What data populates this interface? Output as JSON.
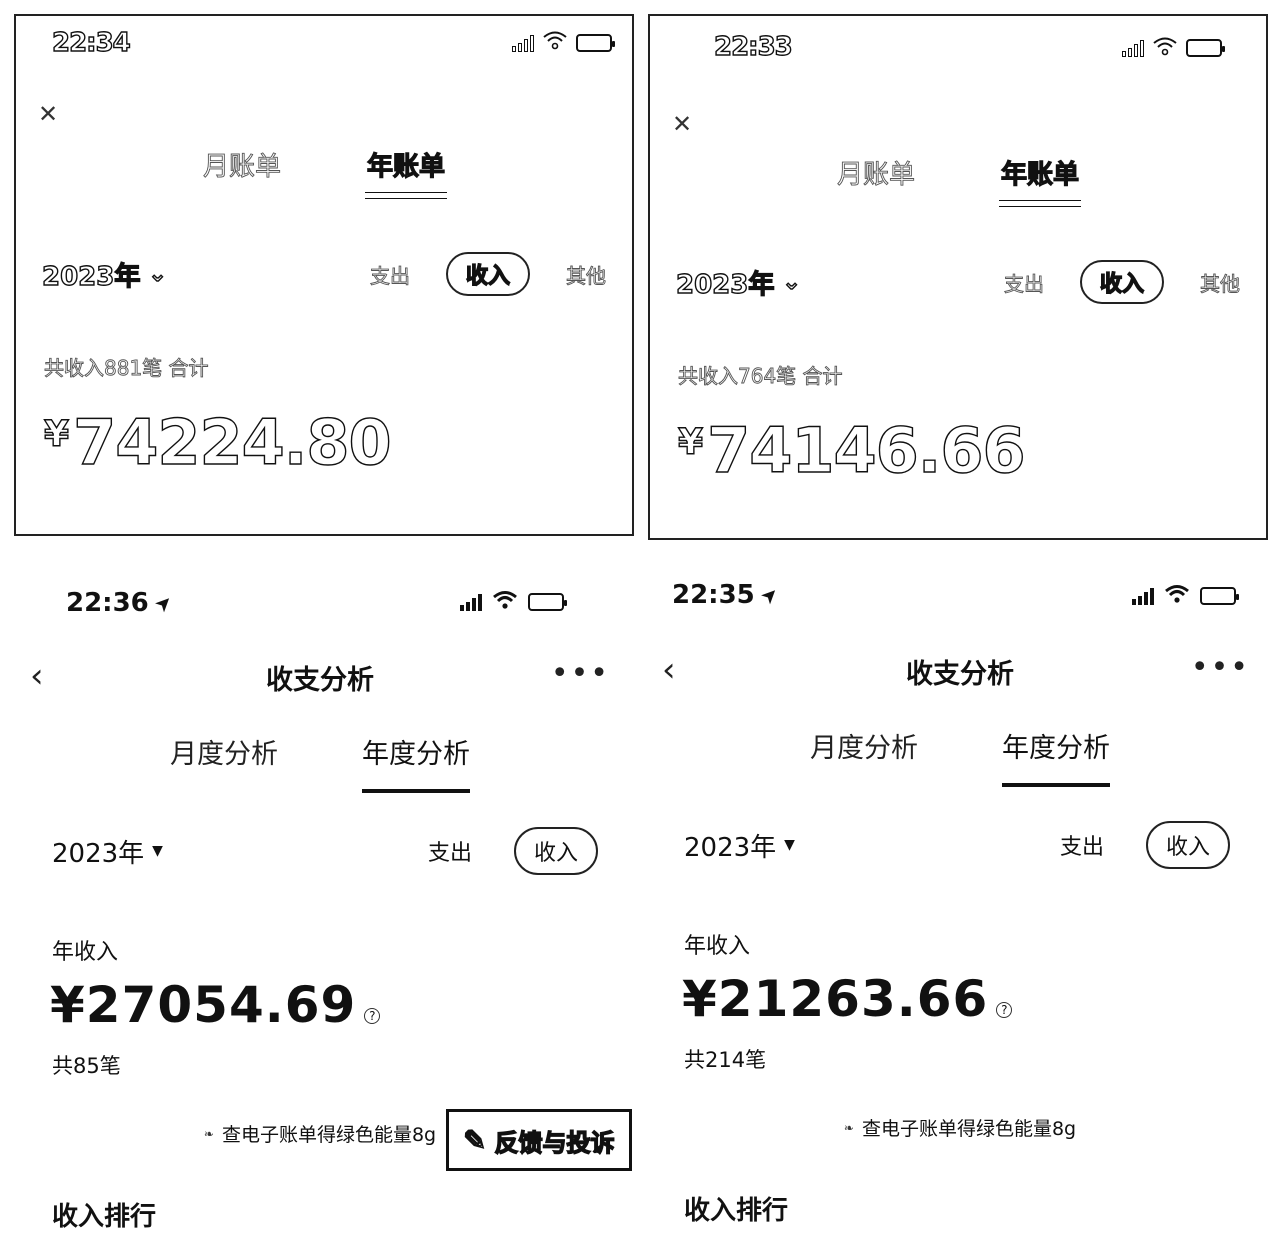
{
  "panels": {
    "top_left": {
      "time": "22:34",
      "tabs": [
        "月账单",
        "年账单"
      ],
      "year": "2023年",
      "types": [
        "支出",
        "收入",
        "其他"
      ],
      "summary": "共收入881笔 合计",
      "currency": "¥",
      "amount": "74224.80"
    },
    "top_right": {
      "time": "22:33",
      "tabs": [
        "月账单",
        "年账单"
      ],
      "year": "2023年",
      "types": [
        "支出",
        "收入",
        "其他"
      ],
      "summary": "共收入764笔 合计",
      "currency": "¥",
      "amount": "74146.66"
    },
    "bottom_left": {
      "time": "22:36",
      "title": "收支分析",
      "tabs": [
        "月度分析",
        "年度分析"
      ],
      "year": "2023年",
      "types": [
        "支出",
        "收入"
      ],
      "label": "年收入",
      "amount": "¥27054.69",
      "count": "共85笔",
      "promo": "查电子账单得绿色能量8g",
      "rank": "收入排行",
      "feedback": "反馈与投诉"
    },
    "bottom_right": {
      "time": "22:35",
      "title": "收支分析",
      "tabs": [
        "月度分析",
        "年度分析"
      ],
      "year": "2023年",
      "types": [
        "支出",
        "收入"
      ],
      "label": "年收入",
      "amount": "¥21263.66",
      "count": "共214笔",
      "promo": "查电子账单得绿色能量8g",
      "rank": "收入排行"
    }
  },
  "icons": {
    "close": "✕",
    "caret": "▼",
    "chevron_down": "⌄",
    "back": "‹",
    "more": "•••",
    "location": "➤",
    "question": "?",
    "leaf": "❧",
    "pen": "✎"
  }
}
